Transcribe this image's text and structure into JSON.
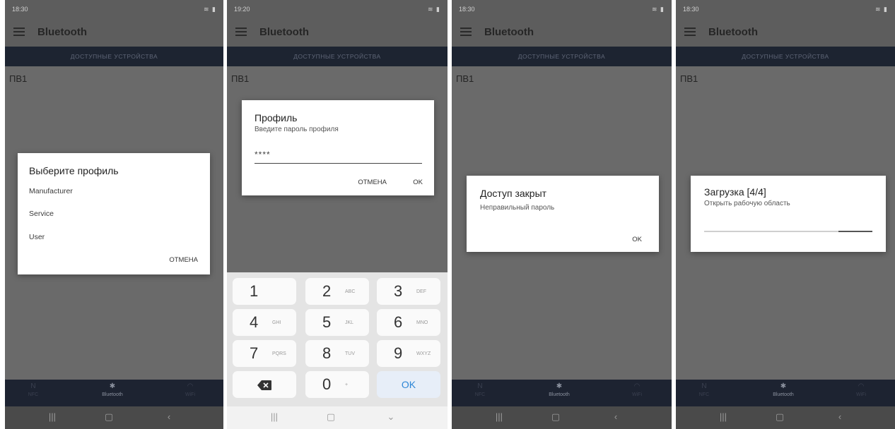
{
  "panels": [
    {
      "status_time": "18:30",
      "app_title": "Bluetooth",
      "tab": "ДОСТУПНЫЕ УСТРОЙСТВА",
      "device": "ПВ1",
      "dialog": {
        "title": "Выберите профиль",
        "options": [
          "Manufacturer",
          "Service",
          "User"
        ],
        "cancel": "ОТМЕНА"
      }
    },
    {
      "status_time": "19:20",
      "app_title": "Bluetooth",
      "tab": "ДОСТУПНЫЕ УСТРОЙСТВА",
      "device": "ПВ1",
      "dialog": {
        "title": "Профиль",
        "subtitle": "Введите пароль профиля",
        "password_value": "****",
        "cancel": "ОТМЕНА",
        "ok": "OK"
      }
    },
    {
      "status_time": "18:30",
      "app_title": "Bluetooth",
      "tab": "ДОСТУПНЫЕ УСТРОЙСТВА",
      "device": "ПВ1",
      "dialog": {
        "title": "Доступ закрыт",
        "message": "Неправильный пароль",
        "ok": "OK"
      }
    },
    {
      "status_time": "18:30",
      "app_title": "Bluetooth",
      "tab": "ДОСТУПНЫЕ УСТРОЙСТВА",
      "device": "ПВ1",
      "dialog": {
        "title": "Загрузка [4/4]",
        "message": "Открыть рабочую область",
        "progress_fraction": 0.84
      }
    }
  ],
  "keypad": {
    "keys": [
      {
        "digit": "1",
        "letters": ""
      },
      {
        "digit": "2",
        "letters": "ABC"
      },
      {
        "digit": "3",
        "letters": "DEF"
      },
      {
        "digit": "4",
        "letters": "GHI"
      },
      {
        "digit": "5",
        "letters": "JKL"
      },
      {
        "digit": "6",
        "letters": "MNO"
      },
      {
        "digit": "7",
        "letters": "PQRS"
      },
      {
        "digit": "8",
        "letters": "TUV"
      },
      {
        "digit": "9",
        "letters": "WXYZ"
      }
    ],
    "zero": "0",
    "plus": "+",
    "ok": "OK",
    "backspace_icon": "backspace-icon"
  },
  "bottom_nav": {
    "items": [
      "NFC",
      "Bluetooth",
      "WiFi"
    ],
    "active": "Bluetooth"
  },
  "icons": {
    "menu": "hamburger-menu-icon",
    "nfc": "nfc-icon",
    "bluetooth": "bluetooth-icon",
    "wifi": "wifi-icon",
    "recent": "recent-apps-icon",
    "home": "home-icon",
    "back": "back-icon"
  },
  "colors": {
    "tab_bar": "#1d2431",
    "background": "#6a6a6a",
    "ok_key_text": "#2d86d6"
  }
}
